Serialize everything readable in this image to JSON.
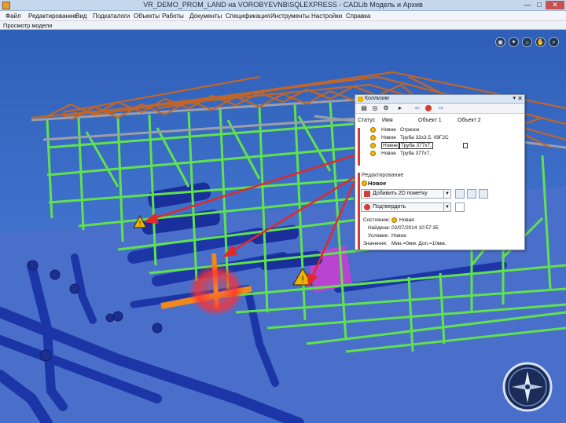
{
  "window": {
    "title": "VR_DEMO_PROM_LAND на VOROBYEVNB\\SQLEXPRESS - CADLib Модель и Архив",
    "minimize": "—",
    "maximize": "□",
    "close": "✕"
  },
  "menu": {
    "items": [
      "Файл",
      "Редактирование",
      "Вид",
      "Подкаталоги",
      "Объекты",
      "Работы",
      "Документы",
      "Спецификация",
      "Инструменты",
      "Настройки",
      "Справка"
    ]
  },
  "model_tab": {
    "label": "Просмотр модели"
  },
  "view_tools": {
    "icons": [
      "camera-icon",
      "pointer-icon",
      "light-icon",
      "hand-icon",
      "zoom-icon"
    ],
    "glyphs": [
      "◉",
      "✦",
      "☼",
      "✋",
      "⌕"
    ]
  },
  "collisions_dialog": {
    "title": "Коллизии",
    "pin": "▾",
    "close": "✕",
    "toolbar_glyphs": [
      "▤",
      "◎",
      "⚙",
      "▸",
      "⇦",
      "⬤",
      "⇨"
    ],
    "columns": {
      "status": "Статус",
      "name": "Имя",
      "object1": "Объект 1",
      "object2": "Объект 2"
    },
    "rows": [
      {
        "name": "Новое",
        "object1": "Отрезок",
        "editing": false
      },
      {
        "name": "Новое",
        "object1": "Труба 32x3.5, 09Г2С",
        "editing": false
      },
      {
        "name": "Новое",
        "object1": "Труба 377x7,",
        "editing": true
      },
      {
        "name": "Новое",
        "object1": "Труба 377x7,",
        "editing": false
      }
    ],
    "edit_section": {
      "caption": "Редактирование",
      "status_name": "Новое",
      "add_mark_label": "Добавить 2D пометку",
      "confirm_label": "Подтвердить",
      "state_label": "Состояние:",
      "state_value": "Новая",
      "found_label": "Найдена:",
      "found_value": "02/07/2014 10:57:35",
      "condition_label": "Условие:",
      "condition_value": "Новое",
      "values_label": "Значения:",
      "values_value": "Мин.=0мм. Доп.=10мм."
    }
  },
  "colors": {
    "sky": "#3d6fc7",
    "ground": "#4f72c9",
    "frame": "#5ee44e",
    "roof": "#c16b2b",
    "pipe": "#1f3bb0",
    "orange_pipe": "#f08a1e",
    "magenta": "#d24bd8",
    "collision": "#e33a3a",
    "dialog_bg": "#ffffff"
  }
}
